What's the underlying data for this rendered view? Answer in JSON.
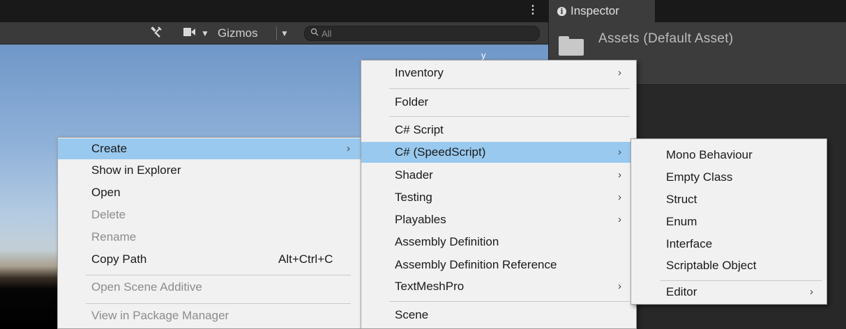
{
  "scene_toolbar": {
    "more_menu_glyph": "⋮",
    "tools_icon": "tools-icon",
    "camera_icon": "camera-icon",
    "gizmos_label": "Gizmos",
    "gizmos_dropdown_glyph": "▼",
    "camera_dropdown_glyph": "▼",
    "search_placeholder": "All"
  },
  "scene_view": {
    "axis_label": "y"
  },
  "inspector": {
    "tab_label": "Inspector",
    "title": "Assets (Default Asset)"
  },
  "menu_main": {
    "items": [
      {
        "label": "Create",
        "state": "highlighted",
        "submenu": true
      },
      {
        "label": "Show in Explorer"
      },
      {
        "label": "Open"
      },
      {
        "label": "Delete",
        "state": "disabled"
      },
      {
        "label": "Rename",
        "state": "disabled"
      },
      {
        "label": "Copy Path",
        "shortcut": "Alt+Ctrl+C"
      },
      {
        "label": "Open Scene Additive",
        "state": "disabled"
      },
      {
        "label": "View in Package Manager",
        "state": "disabled"
      }
    ]
  },
  "menu_create": {
    "items": [
      {
        "label": "Inventory",
        "submenu": true
      },
      {
        "label": "Folder"
      },
      {
        "label": "C# Script"
      },
      {
        "label": "C# (SpeedScript)",
        "state": "highlighted",
        "submenu": true
      },
      {
        "label": "Shader",
        "submenu": true
      },
      {
        "label": "Testing",
        "submenu": true
      },
      {
        "label": "Playables",
        "submenu": true
      },
      {
        "label": "Assembly Definition"
      },
      {
        "label": "Assembly Definition Reference"
      },
      {
        "label": "TextMeshPro",
        "submenu": true
      },
      {
        "label": "Scene"
      }
    ]
  },
  "menu_speedscript": {
    "items": [
      {
        "label": "Mono Behaviour"
      },
      {
        "label": "Empty Class"
      },
      {
        "label": "Struct"
      },
      {
        "label": "Enum"
      },
      {
        "label": "Interface"
      },
      {
        "label": "Scriptable Object"
      },
      {
        "label": "Editor",
        "submenu": true
      }
    ]
  },
  "glyphs": {
    "submenu_arrow": "›",
    "info": "i"
  },
  "colors": {
    "menu_bg": "#f1f1f1",
    "menu_highlight": "#99c9ef",
    "disabled_text": "#8c8c8c",
    "inspector_bg": "#3c3c3c"
  }
}
